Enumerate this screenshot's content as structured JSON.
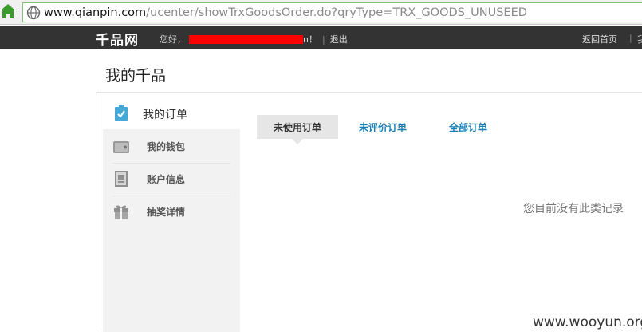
{
  "browser": {
    "url_host": "www.qianpin.com",
    "url_path": "/ucenter/showTrxGoodsOrder.do?qryType=TRX_GOODS_UNUSEED"
  },
  "site_bar": {
    "logo": "千品网",
    "greeting_prefix": "您好，",
    "greeting_suffix": "n！",
    "separator": "|",
    "logout": "退出",
    "back_home": "返回首页",
    "cut_text": "我"
  },
  "page": {
    "title": "我的千品"
  },
  "sidebar": {
    "items": [
      {
        "label": "我的订单",
        "icon": "order-tag-icon",
        "active": true
      },
      {
        "label": "我的钱包",
        "icon": "wallet-icon"
      },
      {
        "label": "账户信息",
        "icon": "account-card-icon"
      },
      {
        "label": "抽奖详情",
        "icon": "gift-icon"
      }
    ]
  },
  "tabs": [
    {
      "label": "未使用订单",
      "active": true
    },
    {
      "label": "未评价订单"
    },
    {
      "label": "全部订单"
    }
  ],
  "empty_message": "您目前没有此类记录",
  "watermark": "www.wooyun.org",
  "colors": {
    "site_bar": "#333333",
    "link_blue": "#1a7fb5",
    "redaction": "#ff0000",
    "url_border": "#7ec46a"
  }
}
